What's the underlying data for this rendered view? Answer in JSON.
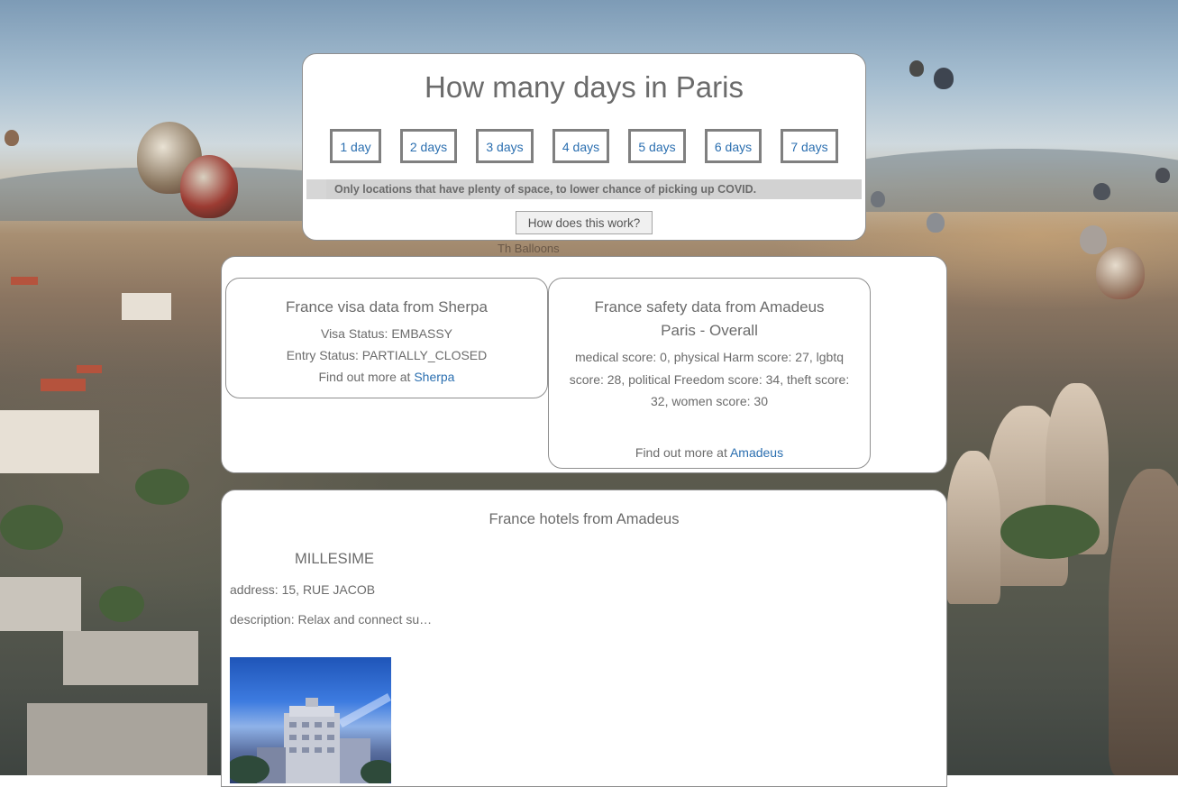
{
  "days_selector": {
    "title": "How many days in Paris",
    "options": [
      "1 day",
      "2 days",
      "3 days",
      "4 days",
      "5 days",
      "6 days",
      "7 days"
    ],
    "notice": "Only locations that have plenty of space, to lower chance of picking up COVID.",
    "help_button": "How does this work?"
  },
  "background_caption": "Th Balloons",
  "visa": {
    "title": "France visa data from Sherpa",
    "visa_status": "Visa Status: EMBASSY",
    "entry_status": "Entry Status: PARTIALLY_CLOSED",
    "more_prefix": "Find out more at ",
    "more_link": "Sherpa"
  },
  "safety": {
    "title": "France safety data from Amadeus",
    "subtitle": "Paris - Overall",
    "scores": "medical score: 0, physical Harm score: 27, lgbtq score: 28, political Freedom score: 34, theft score: 32, women score: 30",
    "more_prefix": "Find out more at ",
    "more_link": "Amadeus"
  },
  "hotels": {
    "title": "France hotels from Amadeus",
    "items": [
      {
        "name": "MILLESIME",
        "address": "address: 15, RUE JACOB",
        "description": "description: Relax and connect su…"
      }
    ]
  },
  "colors": {
    "link": "#2b6fb0",
    "text": "#6b6b6b",
    "notice_bg": "#d2d2d2"
  }
}
